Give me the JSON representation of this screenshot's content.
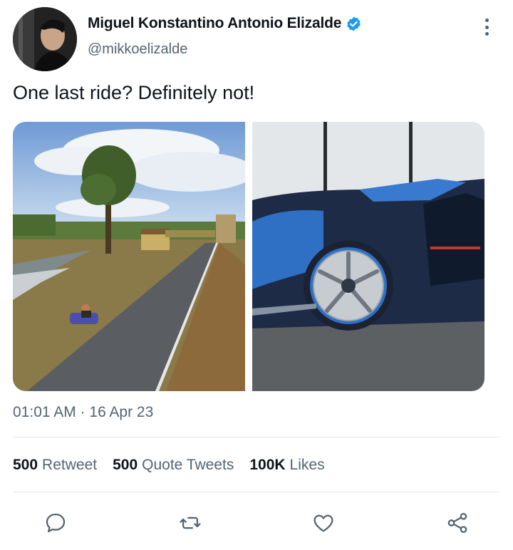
{
  "author": {
    "name": "Miguel Konstantino Antonio Elizalde",
    "handle": "@mikkoelizalde",
    "verified": true,
    "verified_color": "#1d9bf0"
  },
  "tweet": {
    "text": "One last ride? Definitely not!",
    "timestamp": "01:01 AM · 16 Apr 23"
  },
  "media": [
    {
      "description_icon": "photo-go-kart-track"
    },
    {
      "description_icon": "photo-sports-car-wheel"
    }
  ],
  "stats": [
    {
      "count": "500",
      "label": "Retweet"
    },
    {
      "count": "500",
      "label": "Quote Tweets"
    },
    {
      "count": "100K",
      "label": "Likes"
    }
  ],
  "actions": [
    "reply-icon",
    "retweet-icon",
    "like-icon",
    "share-icon"
  ],
  "colors": {
    "text": "#0f1419",
    "secondary": "#536471",
    "accent": "#1d9bf0",
    "divider": "#e1e6ea"
  }
}
